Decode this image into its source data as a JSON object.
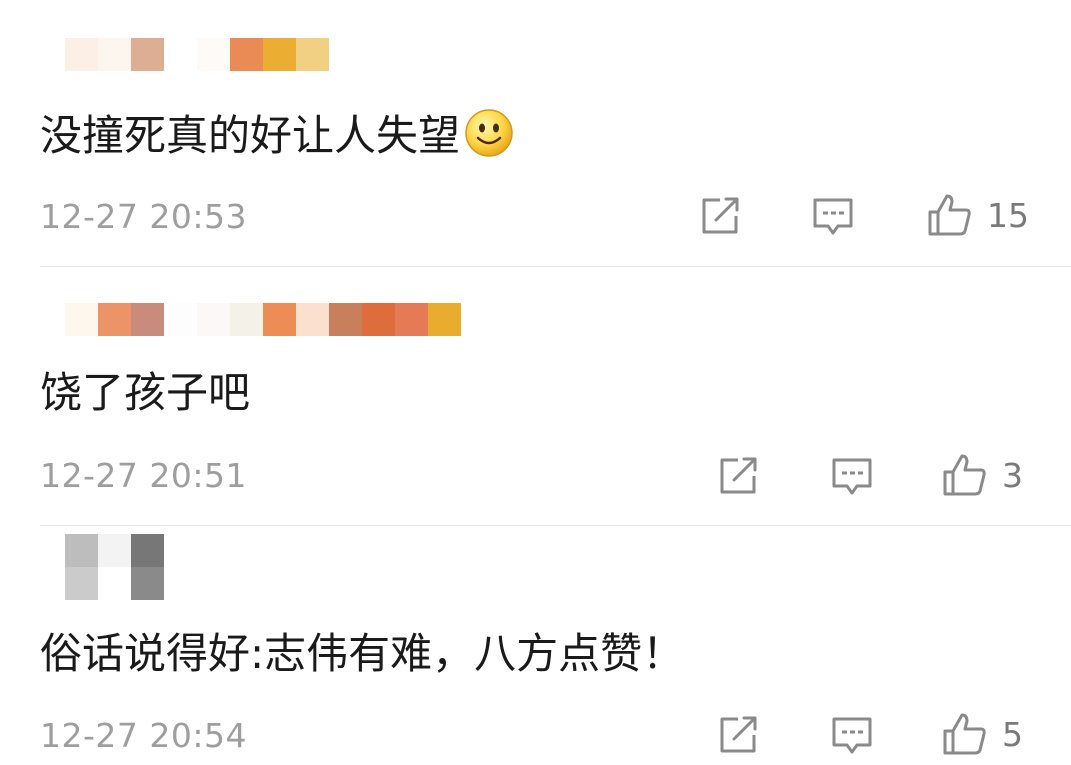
{
  "comments": [
    {
      "text": "没撞死真的好让人失望",
      "emoji": "smiley-emoji",
      "timestamp": "12-27 20:53",
      "likes": "15",
      "username_mosaic": [
        "#fcefe6",
        "#fdf6ef",
        "#dcaf95",
        "#ffffff",
        "#fdfaf8",
        "#ea8a55",
        "#ebae33",
        "#f1cf83"
      ]
    },
    {
      "text": "饶了孩子吧",
      "timestamp": "12-27 20:51",
      "likes": "3",
      "username_mosaic": [
        "#fdf7ee",
        "#ec9467",
        "#c98c7c",
        "#fdfdfd",
        "#fdf8f8",
        "#f3f1e8",
        "#ed8c55",
        "#fce0cf",
        "#c87f5c",
        "#df6c3c",
        "#e57a56",
        "#ffffff",
        "#eaac2e"
      ]
    },
    {
      "text": "俗话说得好:志伟有难，八方点赞！",
      "timestamp": "12-27 20:54",
      "likes": "5",
      "username_mosaic": [
        "#bdbdbd",
        "#f3f3f3",
        "#777777",
        "#cbcbcb",
        "#ffffff",
        "#8a8a8a"
      ]
    }
  ],
  "icons": {
    "share": "share-icon",
    "comment": "comment-icon",
    "like": "thumbs-up-icon"
  },
  "colors": {
    "text": "#1a1a1a",
    "meta": "#9e9e9e",
    "icon": "#8a8a8a",
    "divider": "#e6e6e6"
  }
}
